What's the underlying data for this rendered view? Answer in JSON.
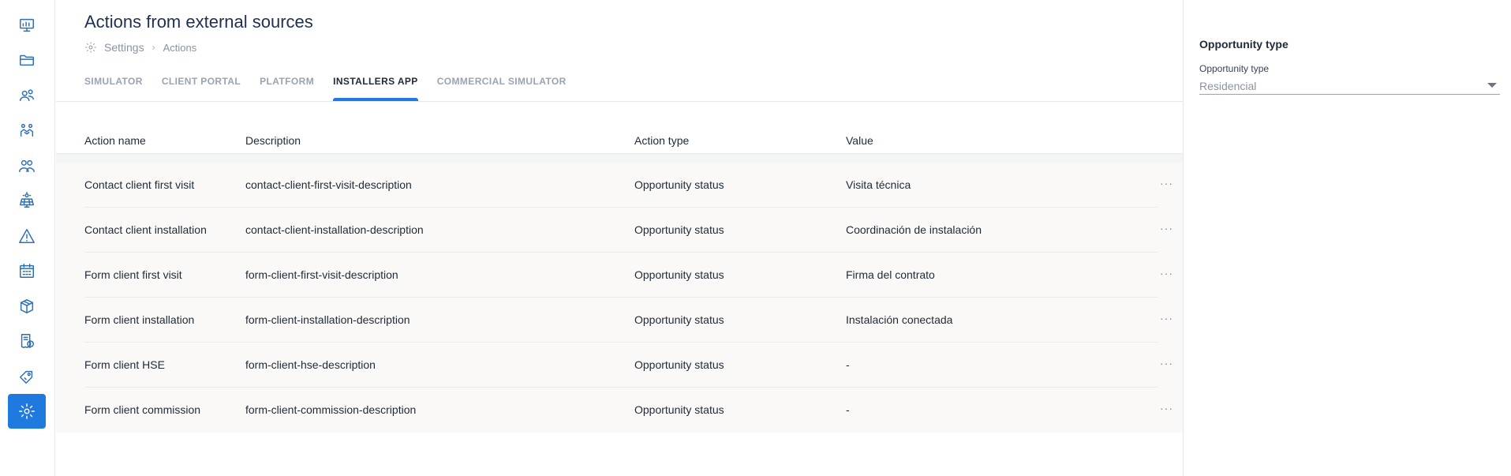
{
  "sidebar": {
    "items": [
      {
        "icon": "presentation-icon",
        "active": false
      },
      {
        "icon": "folder-icon",
        "active": false
      },
      {
        "icon": "users-icon",
        "active": false
      },
      {
        "icon": "handshake-icon",
        "active": false
      },
      {
        "icon": "team-icon",
        "active": false
      },
      {
        "icon": "solar-panel-icon",
        "active": false
      },
      {
        "icon": "warning-icon",
        "active": false
      },
      {
        "icon": "calendar-icon",
        "active": false
      },
      {
        "icon": "package-icon",
        "active": false
      },
      {
        "icon": "invoice-icon",
        "active": false
      },
      {
        "icon": "tag-icon",
        "active": false
      },
      {
        "icon": "settings-icon",
        "active": true
      }
    ],
    "accent": "#1f7ae0"
  },
  "header": {
    "title": "Actions from external sources",
    "breadcrumb": [
      "Settings",
      "Actions"
    ]
  },
  "tabs": [
    {
      "label": "SIMULATOR",
      "active": false
    },
    {
      "label": "CLIENT PORTAL",
      "active": false
    },
    {
      "label": "PLATFORM",
      "active": false
    },
    {
      "label": "INSTALLERS APP",
      "active": true
    },
    {
      "label": "COMMERCIAL SIMULATOR",
      "active": false
    }
  ],
  "table": {
    "columns": [
      "Action name",
      "Description",
      "Action type",
      "Value"
    ],
    "rows": [
      {
        "name": "Contact client first visit",
        "description": "contact-client-first-visit-description",
        "type": "Opportunity status",
        "value": "Visita técnica"
      },
      {
        "name": "Contact client installation",
        "description": "contact-client-installation-description",
        "type": "Opportunity status",
        "value": "Coordinación de instalación"
      },
      {
        "name": "Form client first visit",
        "description": "form-client-first-visit-description",
        "type": "Opportunity status",
        "value": "Firma del contrato"
      },
      {
        "name": "Form client installation",
        "description": "form-client-installation-description",
        "type": "Opportunity status",
        "value": "Instalación conectada"
      },
      {
        "name": "Form client HSE",
        "description": "form-client-hse-description",
        "type": "Opportunity status",
        "value": "-"
      },
      {
        "name": "Form client commission",
        "description": "form-client-commission-description",
        "type": "Opportunity status",
        "value": "-"
      }
    ],
    "row_menu_glyph": "···"
  },
  "filter_panel": {
    "title": "Opportunity type",
    "field_label": "Opportunity type",
    "selected": "Residencial"
  }
}
